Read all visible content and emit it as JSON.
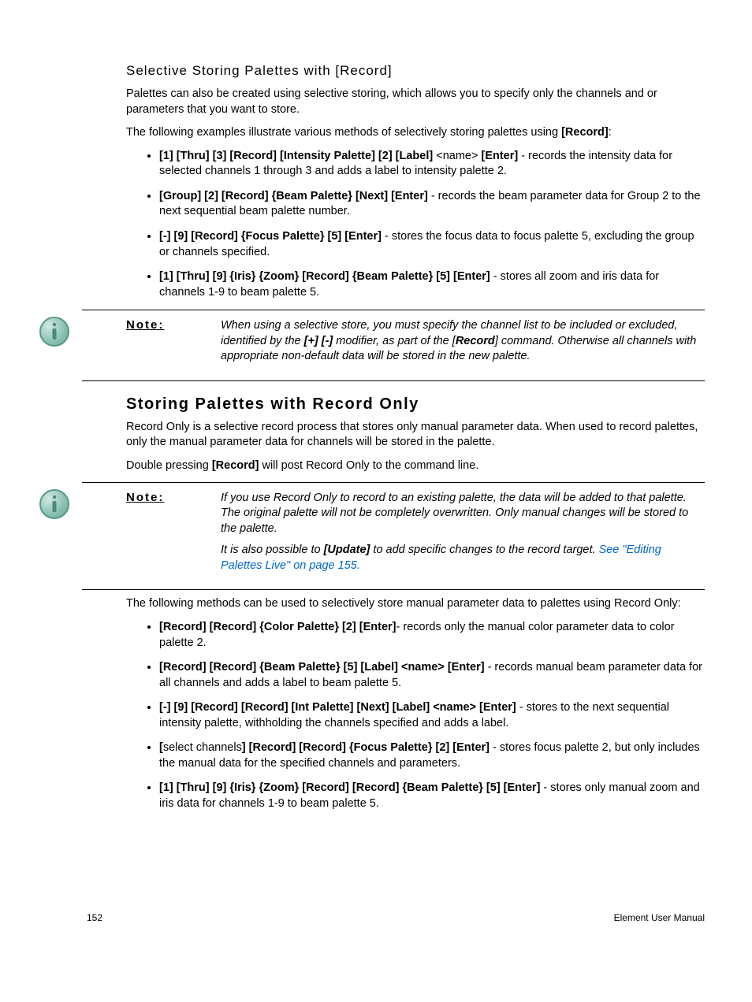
{
  "sec1": {
    "heading": "Selective Storing Palettes with [Record]",
    "p1": "Palettes can also be created using selective storing, which allows you to specify only the channels and or parameters that you want to store.",
    "p2_a": "The following examples illustrate various methods of selectively storing palettes using ",
    "p2_b": "[Record]",
    "p2_c": ":",
    "items": [
      {
        "cmd": "[1] [Thru] [3] [Record] [Intensity Palette] [2] [Label] ",
        "mid": "<name> ",
        "cmd2": "[Enter]",
        "tail": " - records the intensity data for selected channels 1 through 3 and adds a label to intensity palette 2."
      },
      {
        "cmd": "[Group] [2] [Record] {Beam Palette} [Next] [Enter]",
        "tail": " - records the beam parameter data for Group 2 to the next sequential beam palette number."
      },
      {
        "cmd": "[-] [9] [Record] {Focus Palette} [5] [Enter]",
        "tail": " - stores the focus data to focus palette 5, excluding the group or channels specified."
      },
      {
        "cmd": "[1] [Thru] [9] {Iris} {Zoom} [Record] {Beam Palette} [5] [Enter]",
        "tail": " - stores all zoom and iris data for channels 1-9 to beam palette 5."
      }
    ]
  },
  "note1": {
    "label": "Note:",
    "t1": "When using a selective store, you must specify the channel list to be included or excluded, identified by the ",
    "t2": "[+] [-]",
    "t3": " modifier, as part of the [",
    "t4": "Record",
    "t5": "] command. Otherwise all channels with appropriate non-default data will be stored in the new palette."
  },
  "sec2": {
    "heading": "Storing Palettes with Record Only",
    "p1": "Record Only is a selective record process that stores only manual parameter data. When used to record palettes, only the manual parameter data for channels will be stored in the palette.",
    "p2_a": "Double pressing ",
    "p2_b": "[Record]",
    "p2_c": " will post Record Only to the command line."
  },
  "note2": {
    "label": "Note:",
    "p1": "If you use Record Only to record to an existing palette, the data will be added to that palette. The original palette will not be completely overwritten. Only manual changes will be stored to the palette.",
    "p2_a": "It is also possible to ",
    "p2_b": "[Update]",
    "p2_c": " to add specific changes to the record target. ",
    "link": "See \"Editing Palettes Live\" on page 155."
  },
  "sec3": {
    "p1": "The following methods can be used to selectively store manual parameter data to palettes using Record Only:",
    "items": [
      {
        "cmd": "[Record] [Record] {Color Palette} [2] [Enter]",
        "tail": "- records only the manual color parameter data to color palette 2."
      },
      {
        "cmd": "[Record] [Record] {Beam Palette} [5] [Label] <name> [Enter]",
        "tail": " - records manual beam parameter data for all channels and adds a label to beam palette 5."
      },
      {
        "cmd": "[-] [9] [Record] [Record] [Int Palette] [Next] [Label] <name> [Enter]",
        "tail": " - stores to the next sequential intensity palette, withholding the channels specified and adds a label."
      },
      {
        "pre": "[",
        "premid": "select channels",
        "cmd": "] [Record] [Record] {Focus Palette} [2] [Enter]",
        "tail": " - stores focus palette 2, but only includes the manual data for the specified channels and parameters."
      },
      {
        "cmd": "[1] [Thru] [9] {Iris} {Zoom} [Record] [Record] {Beam Palette} [5] [Enter]",
        "tail": " - stores only manual zoom and iris data for channels 1-9 to beam palette 5."
      }
    ]
  },
  "footer": {
    "page": "152",
    "title": "Element User Manual"
  }
}
